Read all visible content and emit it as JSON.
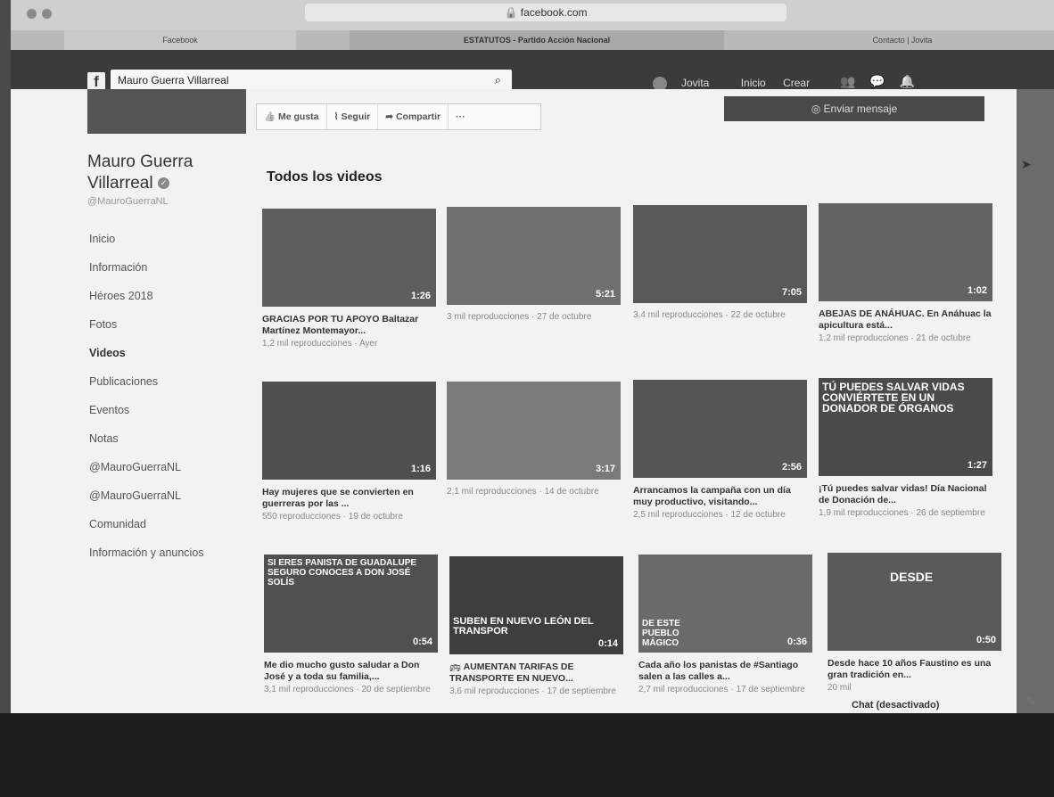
{
  "browser": {
    "url": "facebook.com",
    "tabs": [
      {
        "label": "Facebook"
      },
      {
        "label": "ESTATUTOS - Partido Acción Nacional"
      },
      {
        "label": "Contacto | Jovita"
      }
    ]
  },
  "fb_header": {
    "logo_letter": "f",
    "search_value": "Mauro Guerra Villarreal",
    "user_name": "Jovita",
    "home_label": "Inicio",
    "create_label": "Crear"
  },
  "profile": {
    "name": "Mauro Guerra Villarreal",
    "handle": "@MauroGuerraNL"
  },
  "actions": {
    "like": "Me gusta",
    "follow": "Seguir",
    "share": "Compartir",
    "more": "···",
    "send_message": "Enviar mensaje"
  },
  "sidebar": {
    "items": [
      {
        "label": "Inicio"
      },
      {
        "label": "Información"
      },
      {
        "label": "Héroes 2018"
      },
      {
        "label": "Fotos"
      },
      {
        "label": "Videos"
      },
      {
        "label": "Publicaciones"
      },
      {
        "label": "Eventos"
      },
      {
        "label": "Notas"
      },
      {
        "label": "@MauroGuerraNL"
      },
      {
        "label": "@MauroGuerraNL"
      },
      {
        "label": "Comunidad"
      },
      {
        "label": "Información y anuncios"
      }
    ]
  },
  "videos_section": {
    "title": "Todos los videos",
    "videos": [
      {
        "duration": "1:26",
        "caption": "",
        "title": "GRACIAS POR TU APOYO Baltazar Martínez Montemayor...",
        "meta": "1,2 mil reproducciones · Ayer"
      },
      {
        "duration": "5:21",
        "caption": "",
        "title": "",
        "meta": "3 mil reproducciones · 27 de octubre"
      },
      {
        "duration": "7:05",
        "caption": "",
        "title": "",
        "meta": "3,4 mil reproducciones · 22 de octubre"
      },
      {
        "duration": "1:02",
        "caption": "",
        "title": "ABEJAS DE ANÁHUAC. En Anáhuac la apicultura está...",
        "meta": "1,2 mil reproducciones · 21 de octubre"
      },
      {
        "duration": "1:16",
        "caption": "",
        "title": "Hay mujeres que se convierten en guerreras por las ...",
        "meta": "550 reproducciones · 19 de octubre"
      },
      {
        "duration": "3:17",
        "caption": "",
        "title": "",
        "meta": "2,1 mil reproducciones · 14 de octubre"
      },
      {
        "duration": "2:56",
        "caption": "",
        "title": "Arrancamos la campaña con un día muy productivo, visitando...",
        "meta": "2,5 mil reproducciones · 12 de octubre"
      },
      {
        "duration": "1:27",
        "caption": "TÚ PUEDES SALVAR VIDAS CONVIÉRTETE EN UN DONADOR DE ÓRGANOS",
        "title": "¡Tú puedes salvar vidas! Día Nacional de Donación de...",
        "meta": "1,9 mil reproducciones · 26 de septiembre"
      },
      {
        "duration": "0:54",
        "caption": "SI ERES PANISTA DE GUADALUPE SEGURO CONOCES A DON JOSÉ SOLÍS",
        "title": "Me dio mucho gusto saludar a Don José y a toda su familia,...",
        "meta": "3,1 mil reproducciones · 20 de septiembre"
      },
      {
        "duration": "0:14",
        "caption": "SUBEN EN NUEVO LEÓN DEL TRANSPOR",
        "title": "🚌 AUMENTAN TARIFAS DE TRANSPORTE EN NUEVO...",
        "meta": "3,6 mil reproducciones · 17 de septiembre"
      },
      {
        "duration": "0:36",
        "caption": "DE ESTE PUEBLO MÁGICO",
        "title": "Cada año los panistas de #Santiago salen a las calles a...",
        "meta": "2,7 mil reproducciones · 17 de septiembre"
      },
      {
        "duration": "0:50",
        "caption": "DESDE",
        "title": "Desde hace 10 años Faustino es una gran tradición en...",
        "meta": "20 mil"
      }
    ]
  },
  "chat": {
    "label": "Chat (desactivado)"
  }
}
